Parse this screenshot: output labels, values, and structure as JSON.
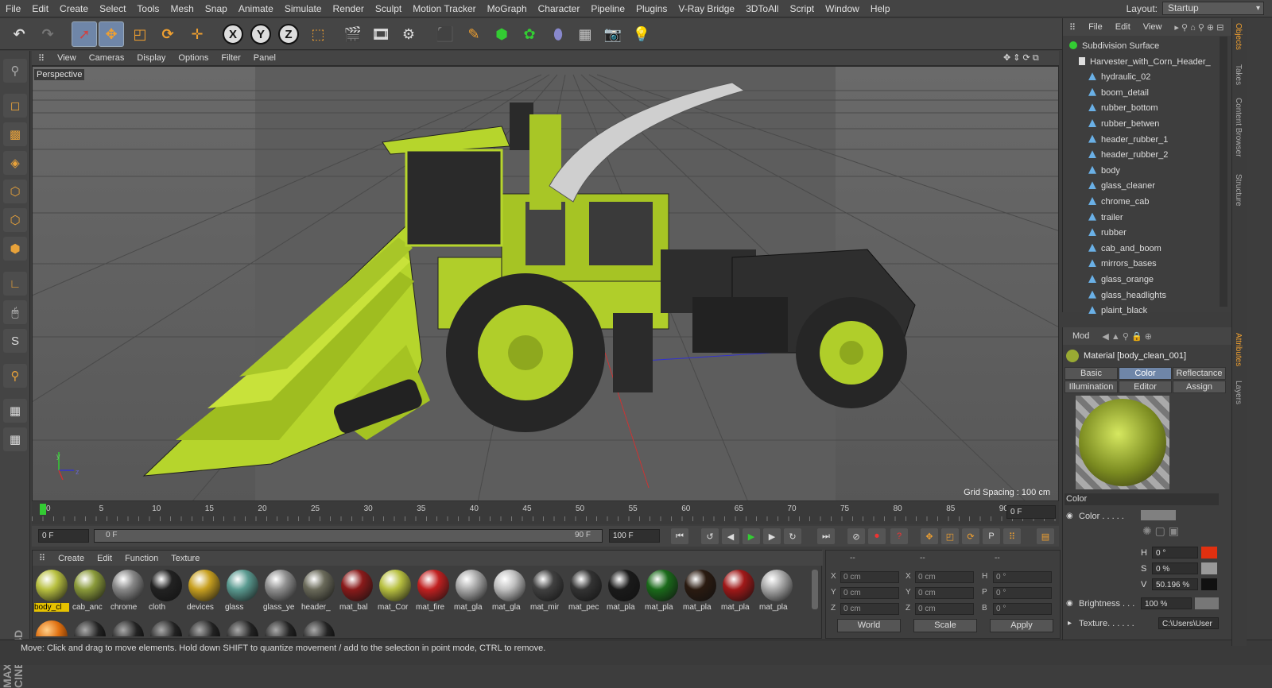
{
  "menubar": {
    "items": [
      "File",
      "Edit",
      "Create",
      "Select",
      "Tools",
      "Mesh",
      "Snap",
      "Animate",
      "Simulate",
      "Render",
      "Sculpt",
      "Motion Tracker",
      "MoGraph",
      "Character",
      "Pipeline",
      "Plugins",
      "V-Ray Bridge",
      "3DToAll",
      "Script",
      "Window",
      "Help"
    ],
    "layout_label": "Layout:",
    "layout_value": "Startup"
  },
  "toolbar": {
    "axis_x": "X",
    "axis_y": "Y",
    "axis_z": "Z"
  },
  "viewport": {
    "menu": [
      "View",
      "Cameras",
      "Display",
      "Options",
      "Filter",
      "Panel"
    ],
    "label": "Perspective",
    "grid_spacing": "Grid Spacing : 100 cm",
    "axis_y": "y",
    "axis_z": "z"
  },
  "timeline": {
    "ticks": [
      "0",
      "5",
      "10",
      "15",
      "20",
      "25",
      "30",
      "35",
      "40",
      "45",
      "50",
      "55",
      "60",
      "65",
      "70",
      "75",
      "80",
      "85",
      "90"
    ],
    "end_frame": "0 F"
  },
  "transport": {
    "current_frame": "0 F",
    "range_start": "0 F",
    "range_end": "90 F",
    "max_frame": "100 F"
  },
  "materials": {
    "menu": [
      "Create",
      "Edit",
      "Function",
      "Texture"
    ],
    "items": [
      {
        "name": "body_cl",
        "color": "#b8c040"
      },
      {
        "name": "cab_anc",
        "color": "#8a9a3a"
      },
      {
        "name": "chrome",
        "color": "#888888"
      },
      {
        "name": "cloth",
        "color": "#222222"
      },
      {
        "name": "devices",
        "color": "#c8a020"
      },
      {
        "name": "glass",
        "color": "#5a9a90"
      },
      {
        "name": "glass_ye",
        "color": "#909090"
      },
      {
        "name": "header_",
        "color": "#6a6a5a"
      },
      {
        "name": "mat_bal",
        "color": "#8a1a1a"
      },
      {
        "name": "mat_Cor",
        "color": "#b8c040"
      },
      {
        "name": "mat_fire",
        "color": "#c02020"
      },
      {
        "name": "mat_gla",
        "color": "#aaaaaa"
      },
      {
        "name": "mat_gla",
        "color": "#c0c0c0"
      },
      {
        "name": "mat_mir",
        "color": "#404040"
      },
      {
        "name": "mat_pec",
        "color": "#333333"
      },
      {
        "name": "mat_pla",
        "color": "#1a1a1a"
      },
      {
        "name": "mat_pla",
        "color": "#1a6a1a"
      },
      {
        "name": "mat_pla",
        "color": "#2a1a10"
      },
      {
        "name": "mat_pla",
        "color": "#a01818"
      },
      {
        "name": "mat_pla",
        "color": "#aaaaaa"
      }
    ]
  },
  "coords": {
    "header_a": "--",
    "header_b": "--",
    "header_c": "--",
    "rows": [
      {
        "l1": "X",
        "v1": "0 cm",
        "l2": "X",
        "v2": "0 cm",
        "l3": "H",
        "v3": "0 °"
      },
      {
        "l1": "Y",
        "v1": "0 cm",
        "l2": "Y",
        "v2": "0 cm",
        "l3": "P",
        "v3": "0 °"
      },
      {
        "l1": "Z",
        "v1": "0 cm",
        "l2": "Z",
        "v2": "0 cm",
        "l3": "B",
        "v3": "0 °"
      }
    ],
    "world": "World",
    "scale": "Scale",
    "apply": "Apply"
  },
  "status": "Move: Click and drag to move elements. Hold down SHIFT to quantize movement / add to the selection in point mode, CTRL to remove.",
  "objects": {
    "menu": [
      "File",
      "Edit",
      "View"
    ],
    "items": [
      {
        "name": "Subdivision Surface",
        "indent": 0
      },
      {
        "name": "Harvester_with_Corn_Header_",
        "indent": 1
      },
      {
        "name": "hydraulic_02",
        "indent": 2
      },
      {
        "name": "boom_detail",
        "indent": 2
      },
      {
        "name": "rubber_bottom",
        "indent": 2
      },
      {
        "name": "rubber_betwen",
        "indent": 2
      },
      {
        "name": "header_rubber_1",
        "indent": 2
      },
      {
        "name": "header_rubber_2",
        "indent": 2
      },
      {
        "name": "body",
        "indent": 2
      },
      {
        "name": "glass_cleaner",
        "indent": 2
      },
      {
        "name": "chrome_cab",
        "indent": 2
      },
      {
        "name": "trailer",
        "indent": 2
      },
      {
        "name": "rubber",
        "indent": 2
      },
      {
        "name": "cab_and_boom",
        "indent": 2
      },
      {
        "name": "mirrors_bases",
        "indent": 2
      },
      {
        "name": "glass_orange",
        "indent": 2
      },
      {
        "name": "glass_headlights",
        "indent": 2
      },
      {
        "name": "plaint_black",
        "indent": 2
      }
    ]
  },
  "sidetabs": [
    "Objects",
    "Takes",
    "Content Browser",
    "Structure",
    "Attributes",
    "Layers"
  ],
  "attributes": {
    "mode": "Mod",
    "material_title": "Material [body_clean_001]",
    "tabs": [
      "Basic",
      "Color",
      "Reflectance",
      "Illumination",
      "Editor",
      "Assign"
    ],
    "section": "Color",
    "color_label": "Color . . . . .",
    "h_label": "H",
    "h_value": "0 °",
    "s_label": "S",
    "s_value": "0 %",
    "v_label": "V",
    "v_value": "50.196 %",
    "brightness_label": "Brightness . . .",
    "brightness_value": "100 %",
    "texture_label": "Texture. . . . . .",
    "texture_value": "C:\\Users\\User"
  }
}
